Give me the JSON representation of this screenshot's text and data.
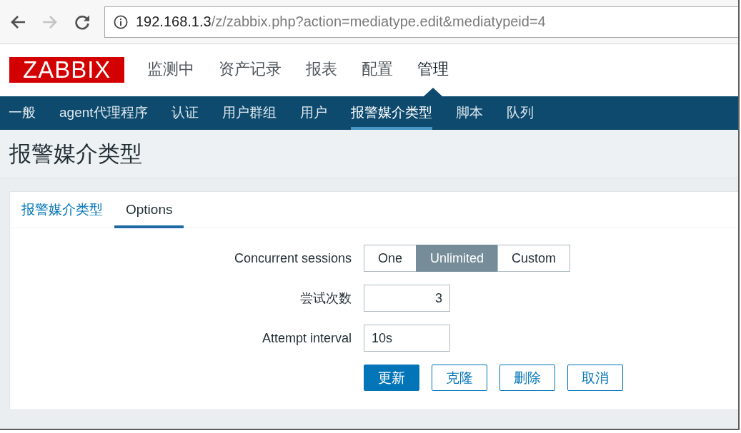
{
  "browser": {
    "nav_buttons": [
      {
        "kind": "back",
        "disabled": false
      },
      {
        "kind": "forward",
        "disabled": true
      },
      {
        "kind": "reload",
        "disabled": false
      }
    ],
    "address": {
      "host": "192.168.1.3",
      "path": "/z/zabbix.php?action=mediatype.edit&mediatypeid=4"
    }
  },
  "header": {
    "logo": "ZABBIX",
    "menu": [
      {
        "label": "监测中",
        "selected": false
      },
      {
        "label": "资产记录",
        "selected": false
      },
      {
        "label": "报表",
        "selected": false
      },
      {
        "label": "配置",
        "selected": false
      },
      {
        "label": "管理",
        "selected": true
      }
    ]
  },
  "subnav": {
    "items": [
      {
        "label": "一般",
        "selected": false
      },
      {
        "label": "agent代理程序",
        "selected": false
      },
      {
        "label": "认证",
        "selected": false
      },
      {
        "label": "用户群组",
        "selected": false
      },
      {
        "label": "用户",
        "selected": false
      },
      {
        "label": "报警媒介类型",
        "selected": true
      },
      {
        "label": "脚本",
        "selected": false
      },
      {
        "label": "队列",
        "selected": false
      }
    ]
  },
  "page_title": "报警媒介类型",
  "tabs": [
    {
      "label": "报警媒介类型",
      "selected": false
    },
    {
      "label": "Options",
      "selected": true
    }
  ],
  "form": {
    "rows": [
      {
        "kind": "segmented",
        "label": "Concurrent sessions",
        "options": [
          {
            "label": "One",
            "selected": false
          },
          {
            "label": "Unlimited",
            "selected": true
          },
          {
            "label": "Custom",
            "selected": false
          }
        ]
      },
      {
        "kind": "number",
        "label": "尝试次数",
        "value": "3"
      },
      {
        "kind": "text",
        "label": "Attempt interval",
        "value": "10s"
      }
    ],
    "buttons": [
      {
        "label": "更新",
        "kind": "primary"
      },
      {
        "label": "克隆",
        "kind": "secondary"
      },
      {
        "label": "删除",
        "kind": "secondary"
      },
      {
        "label": "取消",
        "kind": "secondary"
      }
    ]
  }
}
